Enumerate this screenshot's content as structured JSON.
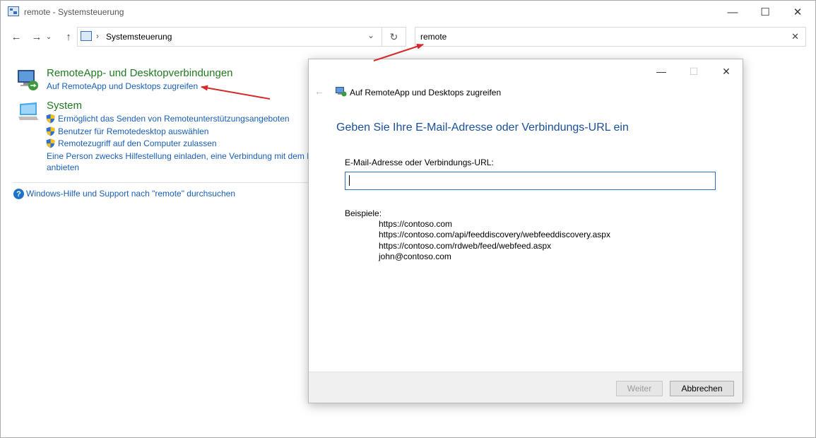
{
  "window": {
    "title": "remote - Systemsteuerung",
    "minimize": "—",
    "maximize": "☐",
    "close": "✕"
  },
  "nav": {
    "back": "←",
    "forward": "→",
    "dropdown_small": "⌄",
    "up": "↑",
    "breadcrumb_sep": "›",
    "address": "Systemsteuerung",
    "address_dropdown": "⌄",
    "refresh": "↻",
    "search_value": "remote",
    "search_clear": "✕"
  },
  "results": {
    "remoteapp": {
      "title": "RemoteApp- und Desktopverbindungen",
      "link": "Auf RemoteApp und Desktops zugreifen"
    },
    "system": {
      "title": "System",
      "links": [
        "Ermöglicht das Senden von Remoteunterstützungsangeboten",
        "Benutzer für Remotedesktop auswählen",
        "Remotezugriff auf den Computer zulassen"
      ],
      "invite_line1": "Eine Person zwecks Hilfestellung einladen, eine Verbindung mit dem PC",
      "invite_line2": "anbieten"
    },
    "help": {
      "icon": "?",
      "link": "Windows-Hilfe und Support nach \"remote\" durchsuchen"
    }
  },
  "dialog": {
    "minimize": "—",
    "maximize": "☐",
    "close": "✕",
    "back": "←",
    "app_title": "Auf RemoteApp und Desktops zugreifen",
    "heading": "Geben Sie Ihre E-Mail-Adresse oder Verbindungs-URL ein",
    "field_label": "E-Mail-Adresse oder Verbindungs-URL:",
    "field_value": "",
    "examples_label": "Beispiele:",
    "examples": [
      "https://contoso.com",
      "https://contoso.com/api/feeddiscovery/webfeeddiscovery.aspx",
      "https://contoso.com/rdweb/feed/webfeed.aspx",
      "john@contoso.com"
    ],
    "next_button": "Weiter",
    "cancel_button": "Abbrechen"
  },
  "colors": {
    "category_green": "#217a21",
    "link_blue": "#1a5fb4",
    "heading_blue": "#1a4f99",
    "arrow_red": "#d42a2a"
  }
}
